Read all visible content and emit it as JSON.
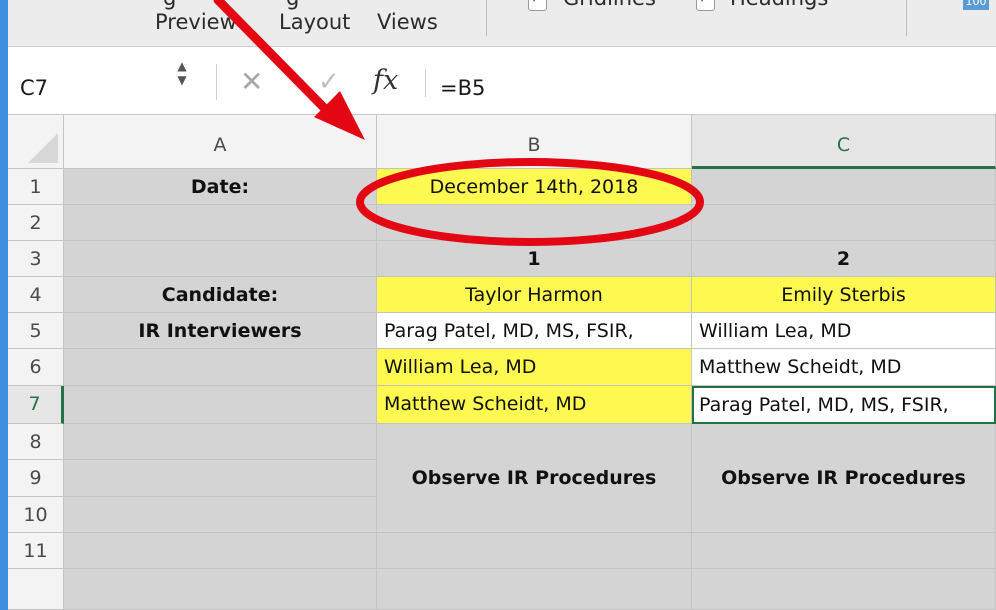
{
  "ribbon": {
    "preview_label": "Preview",
    "layout_label": "Layout",
    "views_label": "Views",
    "gridlines_label": "Gridlines",
    "headings_label": "Headings"
  },
  "formula_bar": {
    "name_box": "C7",
    "fx_label": "fx",
    "formula": "=B5"
  },
  "columns": [
    "A",
    "B",
    "C"
  ],
  "rows": [
    "1",
    "2",
    "3",
    "4",
    "5",
    "6",
    "7",
    "8",
    "9",
    "10",
    "11"
  ],
  "cells": {
    "a1": "Date:",
    "b1": "December 14th, 2018",
    "b3": "1",
    "c3": "2",
    "a4": "Candidate:",
    "b4": "Taylor Harmon",
    "c4": "Emily Sterbis",
    "a5": "IR Interviewers",
    "b5": "Parag Patel, MD, MS, FSIR,",
    "c5": "William Lea, MD",
    "b6": "William Lea, MD",
    "c6": "Matthew Scheidt, MD",
    "b7": "Matthew Scheidt, MD",
    "c7": "Parag Patel, MD, MS, FSIR,",
    "b9": "Observe IR Procedures",
    "c9": "Observe IR Procedures"
  },
  "colors": {
    "yellow_fill": "#fdf950",
    "gray_fill": "#d4d4d4",
    "annotation_red": "#e30613",
    "selection_green": "#217346"
  }
}
